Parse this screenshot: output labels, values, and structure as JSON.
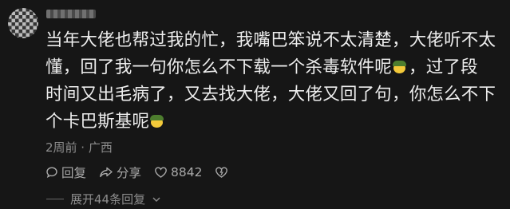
{
  "comment": {
    "line1": "当年大佬也帮过我的忙，我嘴巴笨说不太清楚，大佬听不太",
    "line2": "懂，回了我一句你怎么不下载一个杀毒软件呢",
    "line2_tail": "，过了段",
    "line3": "时间又出毛病了，又去找大佬，大佬又回了句，你怎么不下",
    "line4": "个卡巴斯基呢"
  },
  "meta": {
    "time_location": "2周前 · 广西"
  },
  "actions": {
    "reply_label": "回复",
    "share_label": "分享",
    "like_count": "8842"
  },
  "expand": {
    "label": "展开44条回复"
  },
  "icons": [
    "avatar",
    "laughing-soldier-emoji",
    "reply-icon",
    "share-icon",
    "like-heart-icon",
    "dislike-heart-icon",
    "chevron-down-icon"
  ]
}
